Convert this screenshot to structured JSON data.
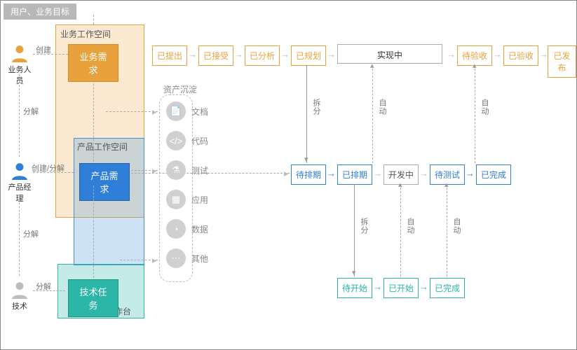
{
  "header": {
    "title": "用户、业务目标"
  },
  "roles": {
    "biz": {
      "label": "业务人员",
      "color": "#e9a23b",
      "edge_create": "创建",
      "edge_decompose": "分解"
    },
    "prod": {
      "label": "产品经理",
      "color": "#2f7ed8",
      "edge": "创建/分解",
      "edge_decompose": "分解"
    },
    "dev": {
      "label": "技术",
      "color": "#9e9e9e",
      "edge": "分解"
    }
  },
  "workspaces": {
    "biz": {
      "label": "业务工作空间"
    },
    "prod": {
      "label": "产品工作空间"
    },
    "dev": {
      "label": "开发者工作台"
    }
  },
  "nodes": {
    "biz_need": "业务需求",
    "prod_need": "产品需求",
    "tech_task": "技术任务"
  },
  "lane_biz": {
    "s1": "已提出",
    "s2": "已接受",
    "s3": "已分析",
    "s4": "已规划",
    "in_progress": "实现中",
    "s5": "待验收",
    "s6": "已验收",
    "s7": "已发布"
  },
  "lane_prod": {
    "s1": "待排期",
    "s2": "已排期",
    "mid": "开发中",
    "s3": "待测试",
    "s4": "已完成"
  },
  "lane_dev": {
    "s1": "待开始",
    "s2": "已开始",
    "s3": "已完成"
  },
  "edge_labels": {
    "split": "拆分",
    "auto": "自动"
  },
  "assets": {
    "title": "资产沉淀",
    "items": {
      "doc": "文档",
      "code": "代码",
      "test": "测试",
      "app": "应用",
      "data": "数据",
      "other": "其他"
    }
  }
}
